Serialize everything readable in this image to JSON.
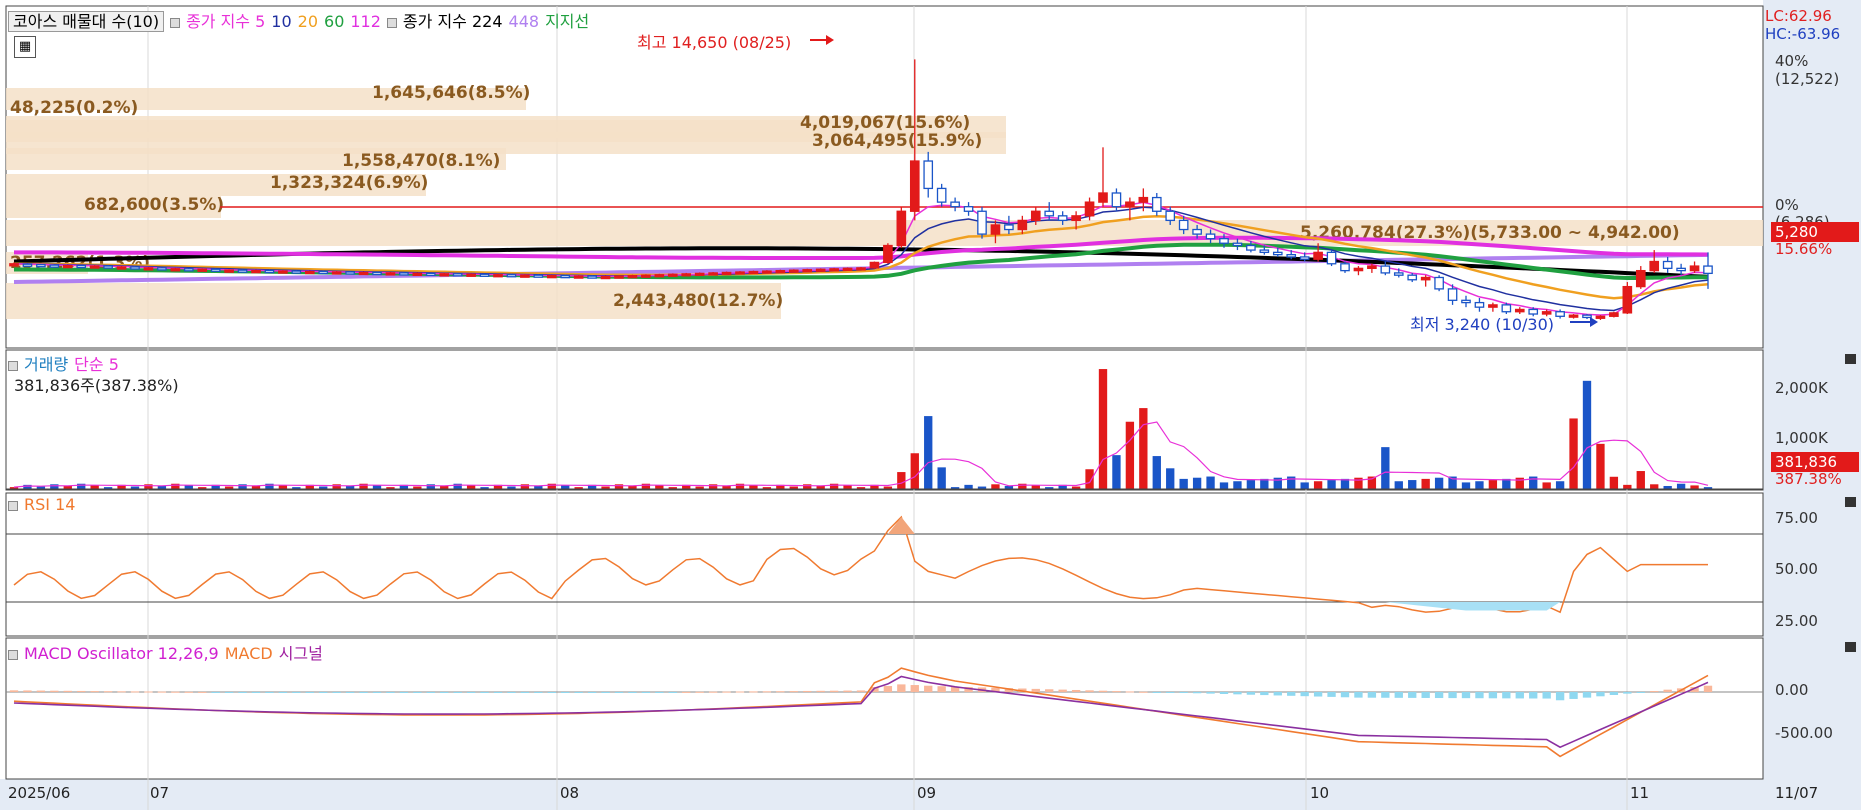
{
  "colors": {
    "up": "#e21a1a",
    "down": "#1a55c8",
    "ma5": "#e830d8",
    "ma10": "#2030a0",
    "ma20": "#f0a020",
    "ma60": "#20a040",
    "ma112": "#e030e0",
    "ma224": "#000000",
    "ma448": "#b080f0",
    "rsi": "#f07a30",
    "macd": "#f07a30",
    "signal": "#8a30a0",
    "osc_pos": "#f9b79a",
    "osc_neg": "#8fd8f0",
    "panel_bg": "#dfe6f0",
    "axis_bg": "#e4ebf5",
    "vp_bar": "#f5e1c8"
  },
  "main": {
    "title_items": [
      "코아스 매물대 수(10)",
      "종가 지수 5",
      "10",
      "20",
      "60",
      "112",
      "종가 지수 224",
      "448",
      "지지선"
    ],
    "high_label": "최고 14,650 (08/25)",
    "low_label": "최저 3,240 (10/30)",
    "lc": "LC:62.96",
    "hc": "HC:-63.96",
    "y_labels": [
      "40%",
      "(12,522)",
      "0%",
      "(6,286)"
    ],
    "cur_price": "5,280",
    "cur_pct": "15.66%",
    "volume_profile": [
      {
        "label": "48,225(0.2%)"
      },
      {
        "label": "1,645,646(8.5%)"
      },
      {
        "label": "4,019,067(15.6%)"
      },
      {
        "label": "3,064,495(15.9%)"
      },
      {
        "label": "1,558,470(8.1%)"
      },
      {
        "label": "1,323,324(6.9%)"
      },
      {
        "label": "682,600(3.5%)"
      },
      {
        "label": "5,260,784(27.3%)(5,733.00 ~ 4,942.00)"
      },
      {
        "label": "257,262(1.3%)"
      },
      {
        "label": "2,443,480(12.7%)"
      }
    ]
  },
  "volume": {
    "title": "거래량",
    "ma_label": "단순 5",
    "value_line": "381,836주(387.38%)",
    "y_labels": [
      "2,000K",
      "1,000K"
    ],
    "cur_value": "381,836",
    "cur_pct": "387.38%"
  },
  "rsi": {
    "title": "RSI 14",
    "y_labels": [
      "75.00",
      "50.00",
      "25.00"
    ]
  },
  "macd": {
    "title": "MACD Oscillator 12,26,9",
    "macd_label": "MACD",
    "signal_label": "시그널",
    "y_labels": [
      "0.00",
      "-500.00"
    ]
  },
  "x_axis": {
    "labels": [
      "2025/06",
      "07",
      "08",
      "09",
      "10",
      "11",
      "11/07"
    ]
  },
  "chart_data": {
    "type": "candlestick",
    "note": "daily candles 2025/06 - 2025/11/07, prices in KRW",
    "ohlc": [
      [
        5700,
        5760,
        5660,
        5700
      ],
      [
        5680,
        5720,
        5620,
        5660
      ],
      [
        5660,
        5700,
        5600,
        5640
      ],
      [
        5640,
        5680,
        5580,
        5600
      ],
      [
        5600,
        5660,
        5560,
        5620
      ],
      [
        5620,
        5660,
        5560,
        5580
      ],
      [
        5580,
        5640,
        5540,
        5600
      ],
      [
        5600,
        5640,
        5520,
        5540
      ],
      [
        5540,
        5600,
        5500,
        5560
      ],
      [
        5560,
        5600,
        5480,
        5500
      ],
      [
        5500,
        5560,
        5460,
        5520
      ],
      [
        5520,
        5560,
        5440,
        5460
      ],
      [
        5460,
        5520,
        5420,
        5480
      ],
      [
        5480,
        5520,
        5400,
        5440
      ],
      [
        5440,
        5500,
        5380,
        5460
      ],
      [
        5460,
        5500,
        5360,
        5400
      ],
      [
        5400,
        5460,
        5340,
        5420
      ],
      [
        5420,
        5460,
        5340,
        5380
      ],
      [
        5380,
        5440,
        5320,
        5400
      ],
      [
        5400,
        5440,
        5320,
        5360
      ],
      [
        5360,
        5420,
        5300,
        5380
      ],
      [
        5380,
        5420,
        5300,
        5340
      ],
      [
        5340,
        5400,
        5280,
        5360
      ],
      [
        5360,
        5400,
        5280,
        5320
      ],
      [
        5320,
        5380,
        5260,
        5340
      ],
      [
        5340,
        5380,
        5260,
        5300
      ],
      [
        5300,
        5360,
        5240,
        5320
      ],
      [
        5320,
        5360,
        5240,
        5280
      ],
      [
        5280,
        5340,
        5220,
        5300
      ],
      [
        5300,
        5340,
        5220,
        5260
      ],
      [
        5260,
        5320,
        5200,
        5280
      ],
      [
        5280,
        5320,
        5200,
        5240
      ],
      [
        5240,
        5300,
        5180,
        5260
      ],
      [
        5260,
        5300,
        5180,
        5220
      ],
      [
        5220,
        5280,
        5160,
        5240
      ],
      [
        5240,
        5280,
        5160,
        5200
      ],
      [
        5200,
        5260,
        5140,
        5220
      ],
      [
        5220,
        5260,
        5140,
        5180
      ],
      [
        5180,
        5240,
        5120,
        5200
      ],
      [
        5200,
        5240,
        5120,
        5160
      ],
      [
        5160,
        5220,
        5100,
        5180
      ],
      [
        5180,
        5220,
        5100,
        5140
      ],
      [
        5140,
        5200,
        5080,
        5160
      ],
      [
        5160,
        5200,
        5080,
        5120
      ],
      [
        5120,
        5180,
        5060,
        5140
      ],
      [
        5140,
        5200,
        5080,
        5160
      ],
      [
        5160,
        5220,
        5100,
        5180
      ],
      [
        5180,
        5240,
        5120,
        5200
      ],
      [
        5200,
        5260,
        5140,
        5220
      ],
      [
        5220,
        5280,
        5160,
        5240
      ],
      [
        5240,
        5300,
        5180,
        5260
      ],
      [
        5260,
        5320,
        5200,
        5280
      ],
      [
        5280,
        5340,
        5220,
        5300
      ],
      [
        5300,
        5360,
        5240,
        5320
      ],
      [
        5320,
        5380,
        5260,
        5340
      ],
      [
        5340,
        5400,
        5280,
        5360
      ],
      [
        5360,
        5420,
        5300,
        5380
      ],
      [
        5380,
        5440,
        5320,
        5400
      ],
      [
        5400,
        5460,
        5340,
        5420
      ],
      [
        5420,
        5480,
        5360,
        5440
      ],
      [
        5440,
        5500,
        5380,
        5460
      ],
      [
        5460,
        5520,
        5400,
        5480
      ],
      [
        5480,
        5540,
        5420,
        5500
      ],
      [
        5500,
        5560,
        5440,
        5520
      ],
      [
        5520,
        5800,
        5480,
        5760
      ],
      [
        5760,
        6600,
        5700,
        6500
      ],
      [
        6500,
        8200,
        6400,
        8000
      ],
      [
        8000,
        14650,
        7600,
        10200
      ],
      [
        10200,
        10600,
        8600,
        9000
      ],
      [
        9000,
        9200,
        8200,
        8400
      ],
      [
        8400,
        8600,
        8000,
        8200
      ],
      [
        8200,
        8400,
        7800,
        8000
      ],
      [
        8000,
        8200,
        6800,
        7000
      ],
      [
        7000,
        7600,
        6600,
        7400
      ],
      [
        7400,
        7800,
        7000,
        7200
      ],
      [
        7200,
        7800,
        7000,
        7600
      ],
      [
        7600,
        8200,
        7400,
        8000
      ],
      [
        8000,
        8400,
        7600,
        7800
      ],
      [
        7800,
        8000,
        7400,
        7600
      ],
      [
        7600,
        8000,
        7200,
        7800
      ],
      [
        7800,
        8600,
        7600,
        8400
      ],
      [
        8400,
        10800,
        8200,
        8800
      ],
      [
        8800,
        9000,
        8000,
        8200
      ],
      [
        8200,
        8600,
        7600,
        8400
      ],
      [
        8400,
        9000,
        8000,
        8600
      ],
      [
        8600,
        8800,
        7800,
        8000
      ],
      [
        8000,
        8200,
        7400,
        7600
      ],
      [
        7600,
        7800,
        7000,
        7200
      ],
      [
        7200,
        7400,
        6800,
        7000
      ],
      [
        7000,
        7200,
        6600,
        6800
      ],
      [
        6800,
        7000,
        6400,
        6600
      ],
      [
        6600,
        6800,
        6300,
        6500
      ],
      [
        6500,
        6700,
        6200,
        6300
      ],
      [
        6300,
        6500,
        6100,
        6200
      ],
      [
        6200,
        6400,
        6000,
        6100
      ],
      [
        6100,
        6300,
        5900,
        6000
      ],
      [
        6000,
        6200,
        5800,
        5900
      ],
      [
        5900,
        6600,
        5800,
        6200
      ],
      [
        6200,
        6300,
        5600,
        5700
      ],
      [
        5700,
        5800,
        5300,
        5400
      ],
      [
        5400,
        5600,
        5200,
        5500
      ],
      [
        5500,
        5700,
        5300,
        5600
      ],
      [
        5600,
        5800,
        5200,
        5300
      ],
      [
        5300,
        5500,
        5100,
        5200
      ],
      [
        5200,
        5300,
        4900,
        5000
      ],
      [
        5000,
        5200,
        4700,
        5100
      ],
      [
        5100,
        5200,
        4500,
        4600
      ],
      [
        4600,
        4800,
        3900,
        4100
      ],
      [
        4100,
        4300,
        3800,
        4000
      ],
      [
        4000,
        4200,
        3600,
        3800
      ],
      [
        3800,
        4000,
        3600,
        3900
      ],
      [
        3900,
        4000,
        3500,
        3600
      ],
      [
        3600,
        3800,
        3500,
        3700
      ],
      [
        3700,
        3800,
        3400,
        3500
      ],
      [
        3500,
        3700,
        3400,
        3600
      ],
      [
        3600,
        3700,
        3300,
        3400
      ],
      [
        3400,
        3500,
        3300,
        3450
      ],
      [
        3450,
        3500,
        3280,
        3350
      ],
      [
        3350,
        3450,
        3240,
        3400
      ],
      [
        3400,
        3600,
        3350,
        3550
      ],
      [
        3550,
        4900,
        3500,
        4700
      ],
      [
        4700,
        5600,
        4600,
        5400
      ],
      [
        5400,
        6300,
        5300,
        5800
      ],
      [
        5800,
        6000,
        5300,
        5500
      ],
      [
        5500,
        5700,
        5200,
        5400
      ],
      [
        5400,
        5800,
        5300,
        5600
      ],
      [
        5600,
        6200,
        4600,
        5280
      ]
    ],
    "volume": [],
    "rsi": [],
    "macd": [],
    "signal": [],
    "osc": []
  }
}
